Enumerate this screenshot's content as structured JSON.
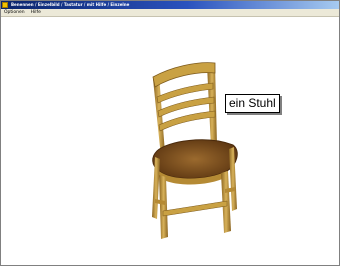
{
  "window": {
    "title": "Benennen / Einzelbild / Tastatur / mit Hilfe / Einzelne"
  },
  "menu": {
    "items": [
      "Optionen",
      "Hilfe"
    ]
  },
  "content": {
    "object_label": "ein Stuhl",
    "image_subject": "chair"
  },
  "colors": {
    "title_gradient_start": "#0a246a",
    "title_gradient_end": "#a6caf0",
    "chair_wood": "#c9a143",
    "chair_seat": "#7a4a1c"
  }
}
